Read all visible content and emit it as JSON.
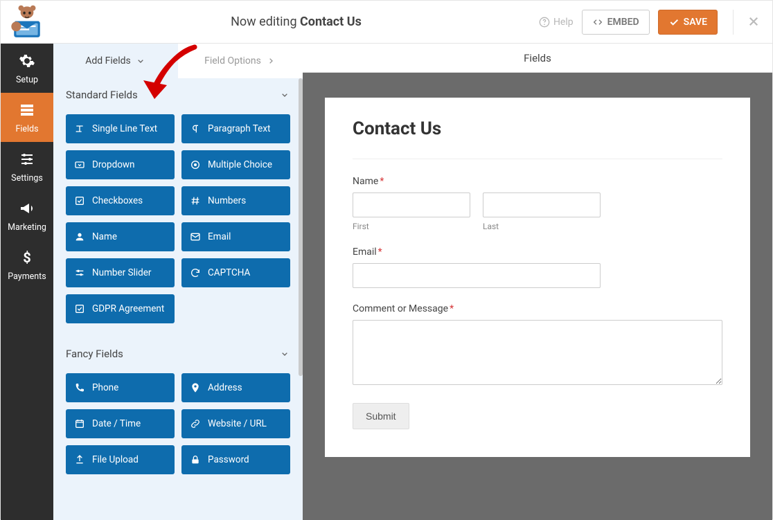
{
  "top": {
    "editing_prefix": "Now editing ",
    "form_name": "Contact Us",
    "help": "Help",
    "embed": "EMBED",
    "save": "SAVE"
  },
  "nav": {
    "setup": "Setup",
    "fields": "Fields",
    "settings": "Settings",
    "marketing": "Marketing",
    "payments": "Payments"
  },
  "panel": {
    "tab_add": "Add Fields",
    "tab_options": "Field Options",
    "group_standard": "Standard Fields",
    "group_fancy": "Fancy Fields",
    "standard": {
      "single_line": "Single Line Text",
      "paragraph": "Paragraph Text",
      "dropdown": "Dropdown",
      "multiple_choice": "Multiple Choice",
      "checkboxes": "Checkboxes",
      "numbers": "Numbers",
      "name": "Name",
      "email": "Email",
      "number_slider": "Number Slider",
      "captcha": "CAPTCHA",
      "gdpr": "GDPR Agreement"
    },
    "fancy": {
      "phone": "Phone",
      "address": "Address",
      "datetime": "Date / Time",
      "website": "Website / URL",
      "file_upload": "File Upload",
      "password": "Password"
    }
  },
  "preview": {
    "bar_title": "Fields",
    "form_title": "Contact Us",
    "label_name": "Name",
    "sub_first": "First",
    "sub_last": "Last",
    "label_email": "Email",
    "label_comment": "Comment or Message",
    "submit": "Submit",
    "required_mark": "*"
  }
}
